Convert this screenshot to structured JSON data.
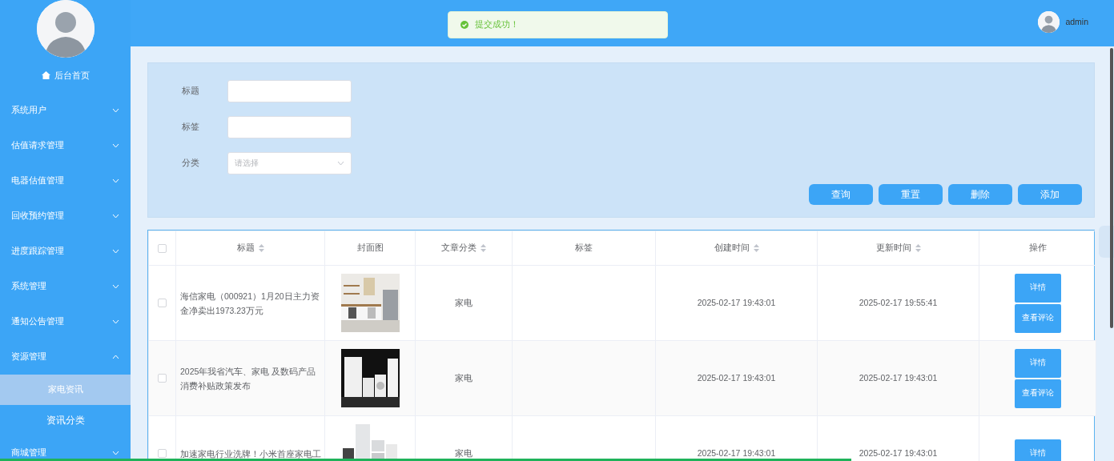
{
  "sidebar": {
    "home": "后台首页",
    "items": [
      {
        "label": "系统用户",
        "expanded": false
      },
      {
        "label": "估值请求管理",
        "expanded": false
      },
      {
        "label": "电器估值管理",
        "expanded": false
      },
      {
        "label": "回收预约管理",
        "expanded": false
      },
      {
        "label": "进度跟踪管理",
        "expanded": false
      },
      {
        "label": "系统管理",
        "expanded": false
      },
      {
        "label": "通知公告管理",
        "expanded": false
      },
      {
        "label": "资源管理",
        "expanded": true,
        "children": [
          {
            "label": "家电资讯",
            "selected": true
          },
          {
            "label": "资讯分类",
            "selected": false
          }
        ]
      },
      {
        "label": "商城管理",
        "expanded": false
      }
    ]
  },
  "toast": {
    "message": "提交成功！"
  },
  "user": {
    "name": "admin"
  },
  "search_form": {
    "fields": [
      {
        "label": "标题",
        "kind": "text"
      },
      {
        "label": "标签",
        "kind": "text"
      },
      {
        "label": "分类",
        "kind": "select",
        "placeholder": "请选择"
      }
    ],
    "buttons": [
      "查询",
      "重置",
      "删除",
      "添加"
    ]
  },
  "table": {
    "header_checked": false,
    "columns": [
      {
        "label": "标题",
        "sortable": true
      },
      {
        "label": "封面图",
        "sortable": false
      },
      {
        "label": "文章分类",
        "sortable": true
      },
      {
        "label": "标签",
        "sortable": false
      },
      {
        "label": "创建时间",
        "sortable": true
      },
      {
        "label": "更新时间",
        "sortable": true
      },
      {
        "label": "操作",
        "sortable": false
      }
    ],
    "rows": [
      {
        "checked": false,
        "title": "海信家电（000921）1月20日主力资金净卖出1973.23万元",
        "cover": {
          "kind": "picture"
        },
        "category": "家电",
        "created": "2025-02-17 19:43:01",
        "updated": "2025-02-17 19:55:41",
        "actions": [
          "详情",
          "查看评论"
        ]
      },
      {
        "checked": false,
        "title": "2025年我省汽车、家电 及数码产品消费补贴政策发布",
        "cover": {
          "kind": "picture"
        },
        "category": "家电",
        "created": "2025-02-17 19:43:01",
        "updated": "2025-02-17 19:43:01",
        "actions": [
          "详情",
          "查看评论"
        ]
      },
      {
        "checked": false,
        "title": "加速家电行业洗牌！小米首座家电工",
        "cover": {
          "kind": "picture"
        },
        "category": "家电",
        "created": "2025-02-17 19:43:01",
        "updated": "2025-02-17 19:43:01",
        "actions": [
          "详情"
        ]
      }
    ]
  },
  "video_progress": {
    "level": 0.764
  }
}
